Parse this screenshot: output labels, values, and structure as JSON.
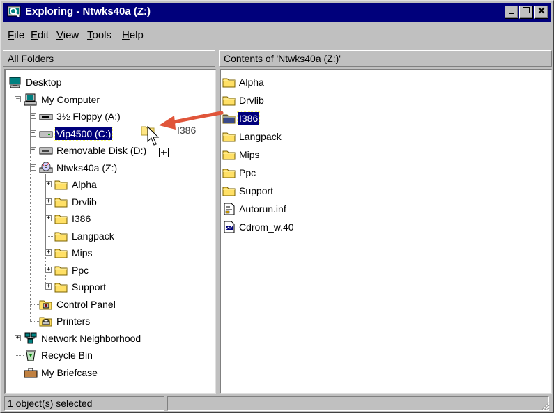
{
  "window": {
    "title": "Exploring - Ntwks40a (Z:)"
  },
  "menu": [
    {
      "underline": "F",
      "rest": "ile"
    },
    {
      "underline": "E",
      "rest": "dit"
    },
    {
      "underline": "V",
      "rest": "iew"
    },
    {
      "underline": "T",
      "rest": "ools"
    },
    {
      "underline": "H",
      "rest": "elp"
    }
  ],
  "headers": {
    "left": "All Folders",
    "right": "Contents of 'Ntwks40a (Z:)'"
  },
  "tree": [
    {
      "label": "Desktop",
      "icon": "desktop-icon",
      "level": 0,
      "expander": ""
    },
    {
      "label": "My Computer",
      "icon": "computer-icon",
      "level": 1,
      "expander": "-"
    },
    {
      "label": "3½ Floppy (A:)",
      "icon": "floppy-drive-icon",
      "level": 2,
      "expander": "+"
    },
    {
      "label": "Vip4500 (C:)",
      "icon": "hard-drive-icon",
      "level": 2,
      "expander": "+",
      "selected": true
    },
    {
      "label": "Removable Disk (D:)",
      "icon": "removable-disk-icon",
      "level": 2,
      "expander": "+"
    },
    {
      "label": "Ntwks40a (Z:)",
      "icon": "cd-drive-icon",
      "level": 2,
      "expander": "-"
    },
    {
      "label": "Alpha",
      "icon": "folder-icon",
      "level": 3,
      "expander": "+"
    },
    {
      "label": "Drvlib",
      "icon": "folder-icon",
      "level": 3,
      "expander": "+"
    },
    {
      "label": "I386",
      "icon": "folder-icon",
      "level": 3,
      "expander": "+"
    },
    {
      "label": "Langpack",
      "icon": "folder-icon",
      "level": 3,
      "expander": ""
    },
    {
      "label": "Mips",
      "icon": "folder-icon",
      "level": 3,
      "expander": "+"
    },
    {
      "label": "Ppc",
      "icon": "folder-icon",
      "level": 3,
      "expander": "+"
    },
    {
      "label": "Support",
      "icon": "folder-icon",
      "level": 3,
      "expander": "+"
    },
    {
      "label": "Control Panel",
      "icon": "control-panel-icon",
      "level": 2,
      "expander": ""
    },
    {
      "label": "Printers",
      "icon": "printers-icon",
      "level": 2,
      "expander": ""
    },
    {
      "label": "Network Neighborhood",
      "icon": "network-icon",
      "level": 1,
      "expander": "+"
    },
    {
      "label": "Recycle Bin",
      "icon": "recycle-bin-icon",
      "level": 1,
      "expander": ""
    },
    {
      "label": "My Briefcase",
      "icon": "briefcase-icon",
      "level": 1,
      "expander": ""
    }
  ],
  "contents": [
    {
      "label": "Alpha",
      "icon": "folder-icon"
    },
    {
      "label": "Drvlib",
      "icon": "folder-icon"
    },
    {
      "label": "I386",
      "icon": "folder-icon",
      "selected": true
    },
    {
      "label": "Langpack",
      "icon": "folder-icon"
    },
    {
      "label": "Mips",
      "icon": "folder-icon"
    },
    {
      "label": "Ppc",
      "icon": "folder-icon"
    },
    {
      "label": "Support",
      "icon": "folder-icon"
    },
    {
      "label": "Autorun.inf",
      "icon": "inf-file-icon"
    },
    {
      "label": "Cdrom_w.40",
      "icon": "file-icon"
    }
  ],
  "drag": {
    "label": "I386",
    "icon": "folder-icon"
  },
  "status": {
    "text": "1 object(s) selected"
  },
  "colors": {
    "titlebar": "#00007b",
    "selection": "#00007b",
    "arrow": "#e0553a",
    "folder": "#ffe066"
  }
}
